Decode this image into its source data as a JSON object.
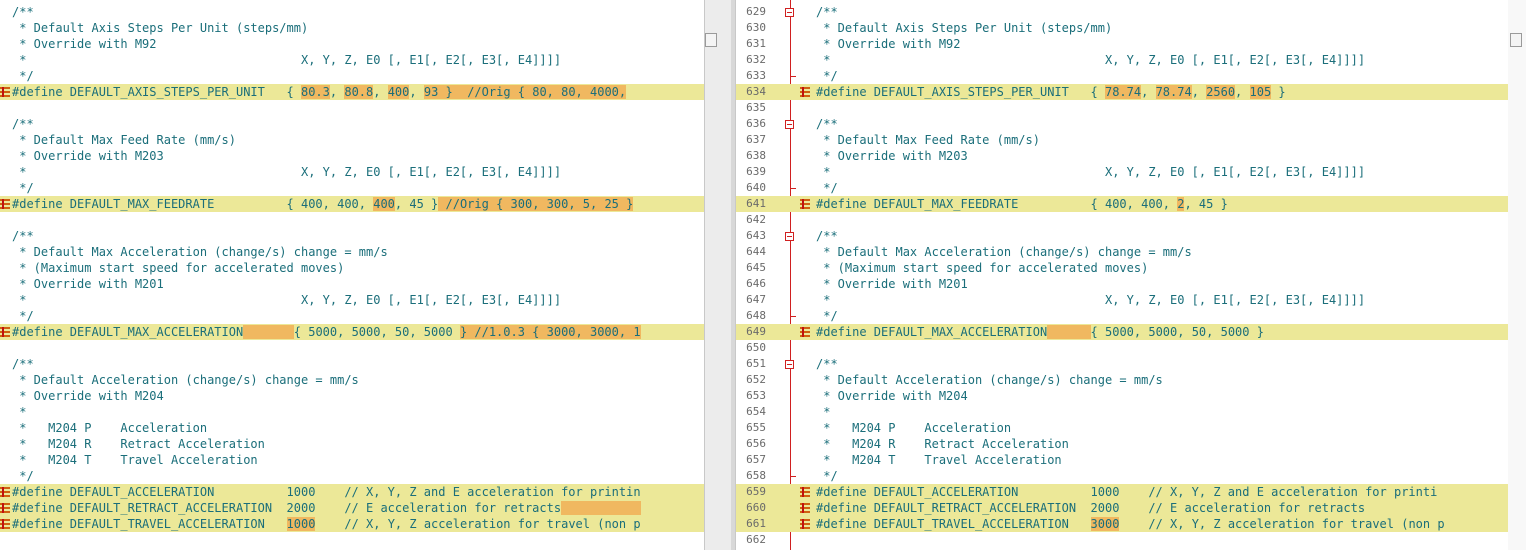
{
  "left": {
    "lines": [
      {
        "segs": [
          {
            "t": "/**"
          }
        ]
      },
      {
        "segs": [
          {
            "t": " * Default Axis Steps Per Unit (steps/mm)"
          }
        ]
      },
      {
        "segs": [
          {
            "t": " * Override with M92"
          }
        ]
      },
      {
        "segs": [
          {
            "t": " *                                      X, Y, Z, E0 [, E1[, E2[, E3[, E4]]]]"
          }
        ]
      },
      {
        "segs": [
          {
            "t": " */"
          }
        ]
      },
      {
        "diff": true,
        "segs": [
          {
            "t": "#define DEFAULT_AXIS_STEPS_PER_UNIT   { "
          },
          {
            "t": "80.3",
            "m": true
          },
          {
            "t": ", "
          },
          {
            "t": "80.8",
            "m": true
          },
          {
            "t": ", "
          },
          {
            "t": "400",
            "m": true
          },
          {
            "t": ", "
          },
          {
            "t": "93 }  //Orig { 80, 80, 4000,",
            "m": true
          }
        ]
      },
      {
        "segs": [
          {
            "t": ""
          }
        ]
      },
      {
        "segs": [
          {
            "t": "/**"
          }
        ]
      },
      {
        "segs": [
          {
            "t": " * Default Max Feed Rate (mm/s)"
          }
        ]
      },
      {
        "segs": [
          {
            "t": " * Override with M203"
          }
        ]
      },
      {
        "segs": [
          {
            "t": " *                                      X, Y, Z, E0 [, E1[, E2[, E3[, E4]]]]"
          }
        ]
      },
      {
        "segs": [
          {
            "t": " */"
          }
        ]
      },
      {
        "diff": true,
        "segs": [
          {
            "t": "#define DEFAULT_MAX_FEEDRATE          { 400, 400, "
          },
          {
            "t": "400",
            "m": true
          },
          {
            "t": ", 45 }"
          },
          {
            "t": " //Orig { 300, 300, 5, 25 }",
            "m": true
          }
        ]
      },
      {
        "segs": [
          {
            "t": ""
          }
        ]
      },
      {
        "segs": [
          {
            "t": "/**"
          }
        ]
      },
      {
        "segs": [
          {
            "t": " * Default Max Acceleration (change/s) change = mm/s"
          }
        ]
      },
      {
        "segs": [
          {
            "t": " * (Maximum start speed for accelerated moves)"
          }
        ]
      },
      {
        "segs": [
          {
            "t": " * Override with M201"
          }
        ]
      },
      {
        "segs": [
          {
            "t": " *                                      X, Y, Z, E0 [, E1[, E2[, E3[, E4]]]]"
          }
        ]
      },
      {
        "segs": [
          {
            "t": " */"
          }
        ]
      },
      {
        "diff": true,
        "segs": [
          {
            "t": "#define DEFAULT_MAX_ACCELERATION"
          },
          {
            "t": "       ",
            "m": true
          },
          {
            "t": "{ 5000, 5000, 50, 5000 "
          },
          {
            "t": "} //1.0.3 { 3000, 3000, 1",
            "m": true
          }
        ]
      },
      {
        "segs": [
          {
            "t": ""
          }
        ]
      },
      {
        "segs": [
          {
            "t": "/**"
          }
        ]
      },
      {
        "segs": [
          {
            "t": " * Default Acceleration (change/s) change = mm/s"
          }
        ]
      },
      {
        "segs": [
          {
            "t": " * Override with M204"
          }
        ]
      },
      {
        "segs": [
          {
            "t": " *"
          }
        ]
      },
      {
        "segs": [
          {
            "t": " *   M204 P    Acceleration"
          }
        ]
      },
      {
        "segs": [
          {
            "t": " *   M204 R    Retract Acceleration"
          }
        ]
      },
      {
        "segs": [
          {
            "t": " *   M204 T    Travel Acceleration"
          }
        ]
      },
      {
        "segs": [
          {
            "t": " */"
          }
        ]
      },
      {
        "diff": true,
        "segs": [
          {
            "t": "#define DEFAULT_ACCELERATION          1000    // X, Y, Z and E acceleration for printin"
          }
        ]
      },
      {
        "diff": true,
        "segs": [
          {
            "t": "#define DEFAULT_RETRACT_ACCELERATION  2000    // E acceleration for retracts"
          },
          {
            "t": "           ",
            "m": true
          }
        ]
      },
      {
        "diff": true,
        "segs": [
          {
            "t": "#define DEFAULT_TRAVEL_ACCELERATION   "
          },
          {
            "t": "1000",
            "m": true
          },
          {
            "t": "    // X, Y, Z acceleration for travel (non p"
          }
        ]
      }
    ]
  },
  "right": {
    "lines": [
      {
        "n": "629",
        "segs": [
          {
            "t": "/**"
          }
        ]
      },
      {
        "n": "630",
        "segs": [
          {
            "t": " * Default Axis Steps Per Unit (steps/mm)"
          }
        ]
      },
      {
        "n": "631",
        "segs": [
          {
            "t": " * Override with M92"
          }
        ]
      },
      {
        "n": "632",
        "segs": [
          {
            "t": " *                                      X, Y, Z, E0 [, E1[, E2[, E3[, E4]]]]"
          }
        ]
      },
      {
        "n": "633",
        "segs": [
          {
            "t": " */"
          }
        ]
      },
      {
        "n": "634",
        "diff": true,
        "segs": [
          {
            "t": "#define DEFAULT_AXIS_STEPS_PER_UNIT   { "
          },
          {
            "t": "78.74",
            "m": true
          },
          {
            "t": ", "
          },
          {
            "t": "78.74",
            "m": true
          },
          {
            "t": ", "
          },
          {
            "t": "2560",
            "m": true
          },
          {
            "t": ", "
          },
          {
            "t": "105",
            "m": true
          },
          {
            "t": " }"
          }
        ]
      },
      {
        "n": "635",
        "segs": [
          {
            "t": ""
          }
        ]
      },
      {
        "n": "636",
        "segs": [
          {
            "t": "/**"
          }
        ]
      },
      {
        "n": "637",
        "segs": [
          {
            "t": " * Default Max Feed Rate (mm/s)"
          }
        ]
      },
      {
        "n": "638",
        "segs": [
          {
            "t": " * Override with M203"
          }
        ]
      },
      {
        "n": "639",
        "segs": [
          {
            "t": " *                                      X, Y, Z, E0 [, E1[, E2[, E3[, E4]]]]"
          }
        ]
      },
      {
        "n": "640",
        "segs": [
          {
            "t": " */"
          }
        ]
      },
      {
        "n": "641",
        "diff": true,
        "segs": [
          {
            "t": "#define DEFAULT_MAX_FEEDRATE          { 400, 400, "
          },
          {
            "t": "2",
            "m": true
          },
          {
            "t": ", 45 }"
          }
        ]
      },
      {
        "n": "642",
        "segs": [
          {
            "t": ""
          }
        ]
      },
      {
        "n": "643",
        "segs": [
          {
            "t": "/**"
          }
        ]
      },
      {
        "n": "644",
        "segs": [
          {
            "t": " * Default Max Acceleration (change/s) change = mm/s"
          }
        ]
      },
      {
        "n": "645",
        "segs": [
          {
            "t": " * (Maximum start speed for accelerated moves)"
          }
        ]
      },
      {
        "n": "646",
        "segs": [
          {
            "t": " * Override with M201"
          }
        ]
      },
      {
        "n": "647",
        "segs": [
          {
            "t": " *                                      X, Y, Z, E0 [, E1[, E2[, E3[, E4]]]]"
          }
        ]
      },
      {
        "n": "648",
        "segs": [
          {
            "t": " */"
          }
        ]
      },
      {
        "n": "649",
        "diff": true,
        "segs": [
          {
            "t": "#define DEFAULT_MAX_ACCELERATION"
          },
          {
            "t": "      ",
            "m": true
          },
          {
            "t": "{ 5000, 5000, 50, 5000 }"
          }
        ]
      },
      {
        "n": "650",
        "segs": [
          {
            "t": ""
          }
        ]
      },
      {
        "n": "651",
        "segs": [
          {
            "t": "/**"
          }
        ]
      },
      {
        "n": "652",
        "segs": [
          {
            "t": " * Default Acceleration (change/s) change = mm/s"
          }
        ]
      },
      {
        "n": "653",
        "segs": [
          {
            "t": " * Override with M204"
          }
        ]
      },
      {
        "n": "654",
        "segs": [
          {
            "t": " *"
          }
        ]
      },
      {
        "n": "655",
        "segs": [
          {
            "t": " *   M204 P    Acceleration"
          }
        ]
      },
      {
        "n": "656",
        "segs": [
          {
            "t": " *   M204 R    Retract Acceleration"
          }
        ]
      },
      {
        "n": "657",
        "segs": [
          {
            "t": " *   M204 T    Travel Acceleration"
          }
        ]
      },
      {
        "n": "658",
        "segs": [
          {
            "t": " */"
          }
        ]
      },
      {
        "n": "659",
        "diff": true,
        "segs": [
          {
            "t": "#define DEFAULT_ACCELERATION          1000    // X, Y, Z and E acceleration for printi"
          }
        ]
      },
      {
        "n": "660",
        "diff": true,
        "segs": [
          {
            "t": "#define DEFAULT_RETRACT_ACCELERATION  2000    // E acceleration for retracts"
          }
        ]
      },
      {
        "n": "661",
        "diff": true,
        "segs": [
          {
            "t": "#define DEFAULT_TRAVEL_ACCELERATION   "
          },
          {
            "t": "3000",
            "m": true
          },
          {
            "t": "    // X, Y, Z acceleration for travel (non p"
          }
        ]
      },
      {
        "n": "662",
        "segs": [
          {
            "t": ""
          }
        ]
      }
    ]
  },
  "colors": {
    "diff_line": "#ece898",
    "diff_mark": "#f0b860",
    "code_text": "#1a6e7a",
    "fold_line": "#d02020"
  },
  "icons": {
    "change_marker": "diff-change-flag-icon",
    "fold_toggle": "fold-collapse-icon"
  }
}
